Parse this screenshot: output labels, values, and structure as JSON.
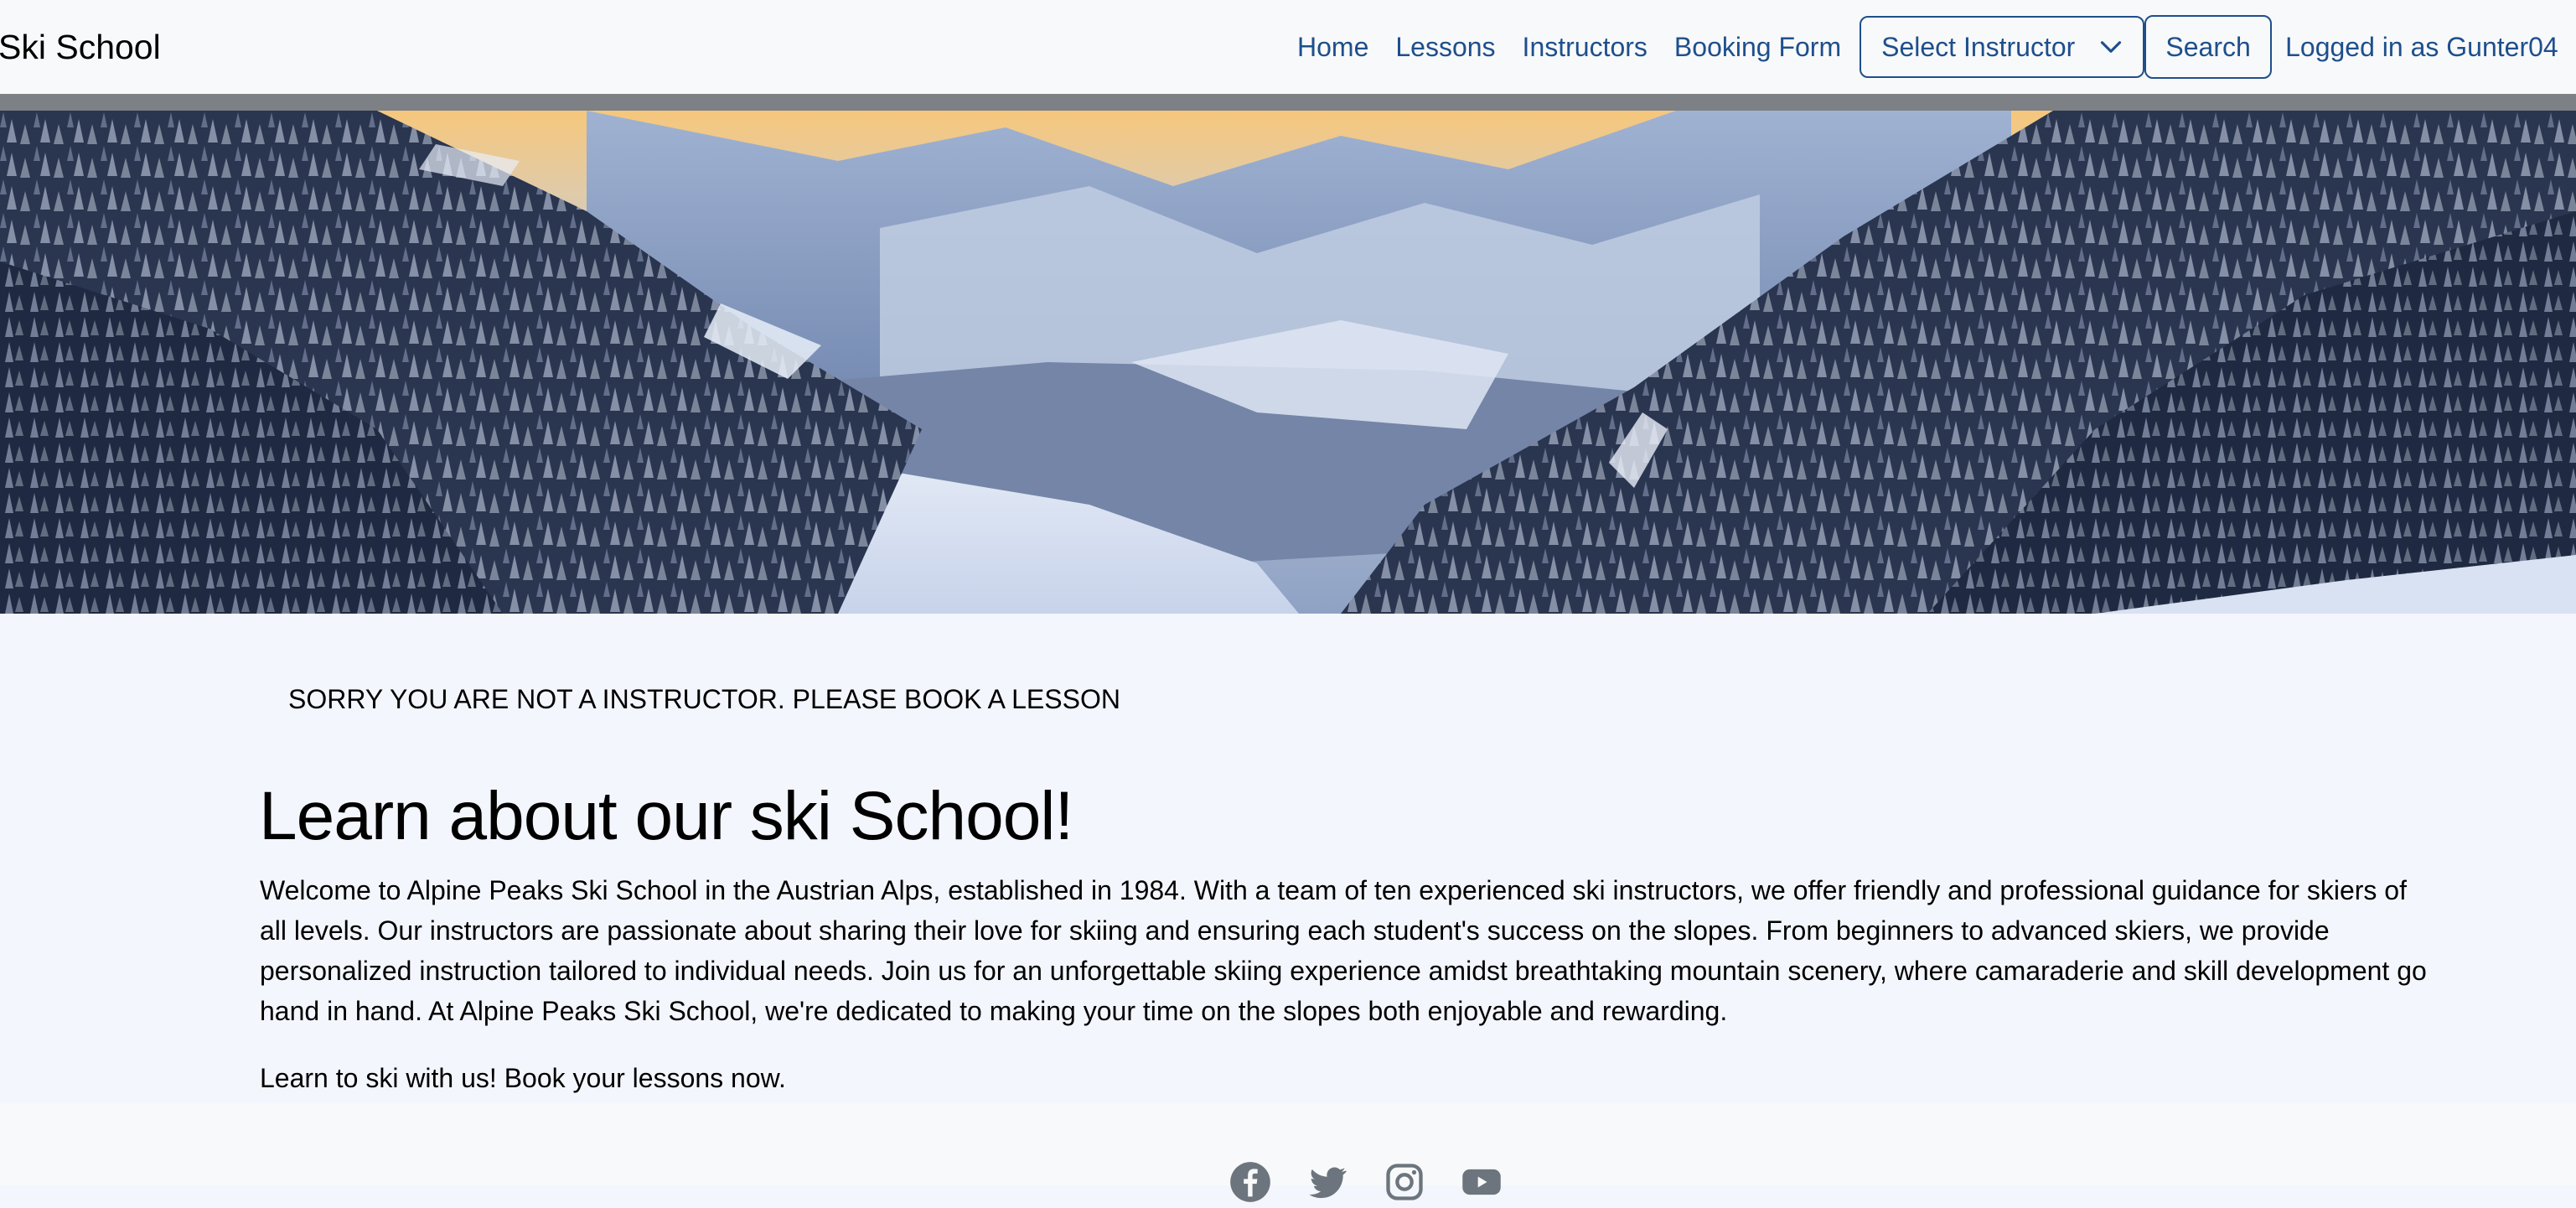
{
  "navbar": {
    "brand": "Ski School",
    "links": [
      "Home",
      "Lessons",
      "Instructors",
      "Booking Form"
    ],
    "select_instructor": "Select Instructor",
    "search_label": "Search",
    "logged_in": "Logged in as Gunter04"
  },
  "main": {
    "notice": "SORRY YOU ARE NOT A INSTRUCTOR. PLEASE BOOK A LESSON",
    "heading": "Learn about our ski School!",
    "paragraph": "Welcome to Alpine Peaks Ski School in the Austrian Alps, established in 1984. With a team of ten experienced ski instructors, we offer friendly and professional guidance for skiers of all levels. Our instructors are passionate about sharing their love for skiing and ensuring each student's success on the slopes. From beginners to advanced skiers, we provide personalized instruction tailored to individual needs. Join us for an unforgettable skiing experience amidst breathtaking mountain scenery, where camaraderie and skill development go hand in hand. At Alpine Peaks Ski School, we're dedicated to making your time on the slopes both enjoyable and rewarding.",
    "cta": "Learn to ski with us! Book your lessons now."
  },
  "footer": {
    "social_icons": [
      "facebook-icon",
      "twitter-icon",
      "instagram-icon",
      "youtube-icon"
    ]
  },
  "colors": {
    "link": "#1e4f8c",
    "navbar_bg": "#f8f9fa",
    "divider": "#7d8084",
    "page_bg": "#f3f6fc",
    "icon": "#6c757d"
  }
}
